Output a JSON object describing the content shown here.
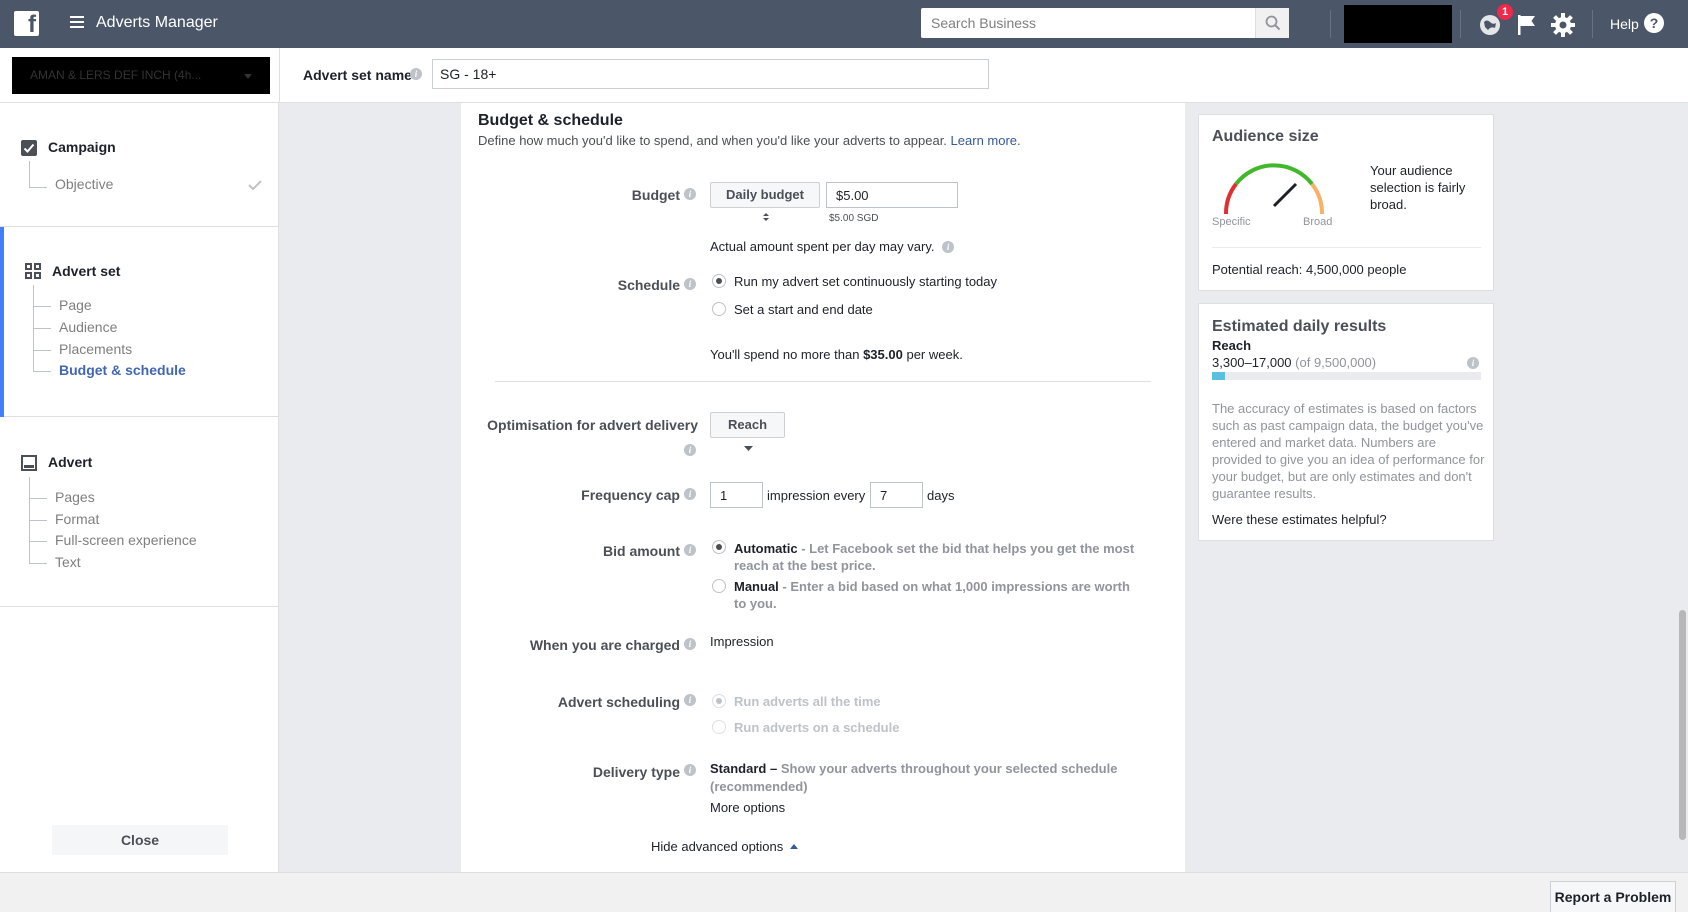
{
  "topbar": {
    "app_title": "Adverts Manager",
    "search_placeholder": "Search Business",
    "notification_count": "1",
    "help_label": "Help"
  },
  "header": {
    "account_selector_text": "AMAN & LERS DEF INCH (4h...",
    "advert_set_name_label": "Advert set name",
    "advert_set_name_value": "SG - 18+"
  },
  "sidebar": {
    "campaign": {
      "title": "Campaign",
      "items": [
        {
          "label": "Objective"
        }
      ]
    },
    "advert_set": {
      "title": "Advert set",
      "items": [
        {
          "label": "Page"
        },
        {
          "label": "Audience"
        },
        {
          "label": "Placements"
        },
        {
          "label": "Budget & schedule"
        }
      ]
    },
    "advert": {
      "title": "Advert",
      "items": [
        {
          "label": "Pages"
        },
        {
          "label": "Format"
        },
        {
          "label": "Full-screen experience"
        },
        {
          "label": "Text"
        }
      ]
    },
    "close_label": "Close"
  },
  "form": {
    "title": "Budget & schedule",
    "description": "Define how much you'd like to spend, and when you'd like your adverts to appear.",
    "learn_more": "Learn more.",
    "budget": {
      "label": "Budget",
      "type": "Daily budget",
      "amount": "$5.00",
      "amount_note": "$5.00 SGD",
      "actual_note": "Actual amount spent per day may vary."
    },
    "schedule": {
      "label": "Schedule",
      "option1": "Run my advert set continuously starting today",
      "option2": "Set a start and end date",
      "spend_prefix": "You'll spend no more than",
      "spend_amount": "$35.00",
      "spend_suffix": "per week."
    },
    "optimisation": {
      "label": "Optimisation for advert delivery",
      "value": "Reach"
    },
    "frequency": {
      "label": "Frequency cap",
      "impressions": "1",
      "middle": "impression every",
      "days": "7",
      "suffix": "days"
    },
    "bid": {
      "label": "Bid amount",
      "auto_title": "Automatic",
      "auto_desc": "- Let Facebook set the bid that helps you get the most reach at the best price.",
      "manual_title": "Manual",
      "manual_desc": "- Enter a bid based on what 1,000 impressions are worth to you."
    },
    "charged": {
      "label": "When you are charged",
      "value": "Impression"
    },
    "ad_scheduling": {
      "label": "Advert scheduling",
      "option1": "Run adverts all the time",
      "option2": "Run adverts on a schedule"
    },
    "delivery": {
      "label": "Delivery type",
      "title": "Standard –",
      "desc": "Show your adverts throughout your selected schedule (recommended)",
      "more_options": "More options"
    },
    "hide_advanced": "Hide advanced options"
  },
  "audience": {
    "title": "Audience size",
    "gauge_left": "Specific",
    "gauge_right": "Broad",
    "summary": "Your audience selection is fairly broad.",
    "potential_reach": "Potential reach: 4,500,000 people"
  },
  "estimates": {
    "title": "Estimated daily results",
    "metric": "Reach",
    "range": "3,300–17,000",
    "of_total": "(of 9,500,000)",
    "reach_fraction": 0.05,
    "disclaimer": "The accuracy of estimates is based on factors such as past campaign data, the budget you've entered and market data. Numbers are provided to give you an idea of performance for your budget, but are only estimates and don't guarantee results.",
    "feedback_link": "Were these estimates helpful?"
  },
  "footer": {
    "report_label": "Report a Problem"
  }
}
